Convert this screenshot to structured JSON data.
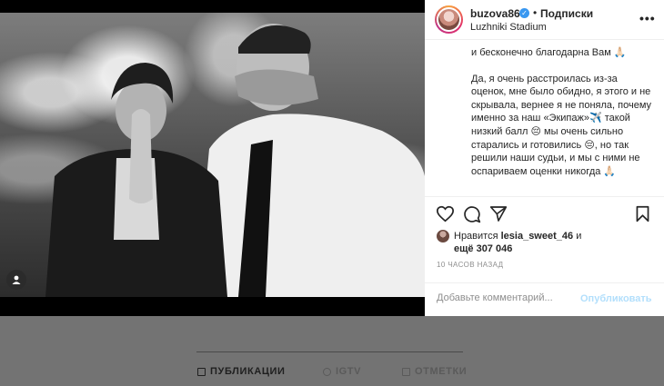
{
  "post": {
    "username": "buzova86",
    "verified_icon": "verified-badge-icon",
    "separator": "•",
    "follow_label": "Подписки",
    "location": "Luzhniki Stadium",
    "more_label": "•••",
    "caption": [
      "и бесконечно благодарна Вам 🙏🏻",
      "Да, я очень расстроилась из-за оценок, мне было обидно, я этого и не скрывала, вернее я не поняла, почему именно за наш «Экипаж»✈️ такой низкий балл 😔 мы очень сильно старались и готовились 😔, но так решили наши судьи, и мы с ними не оспариваем оценки никогда 🙏🏻"
    ],
    "likes": {
      "prefix": "Нравится",
      "user": "lesia_sweet_46",
      "conj": "и",
      "more": "ещё 307 046"
    },
    "time": "10 ЧАСОВ НАЗАД",
    "comment_placeholder": "Добавьте комментарий...",
    "publish_label": "Опубликовать",
    "colors": {
      "verified": "#3897f0",
      "publish_disabled": "#b2dffc",
      "text": "#262626",
      "muted": "#8e8e8e"
    }
  },
  "profile_tabs": {
    "posts": "ПУБЛИКАЦИИ",
    "igtv": "IGTV",
    "tagged": "ОТМЕТКИ"
  }
}
